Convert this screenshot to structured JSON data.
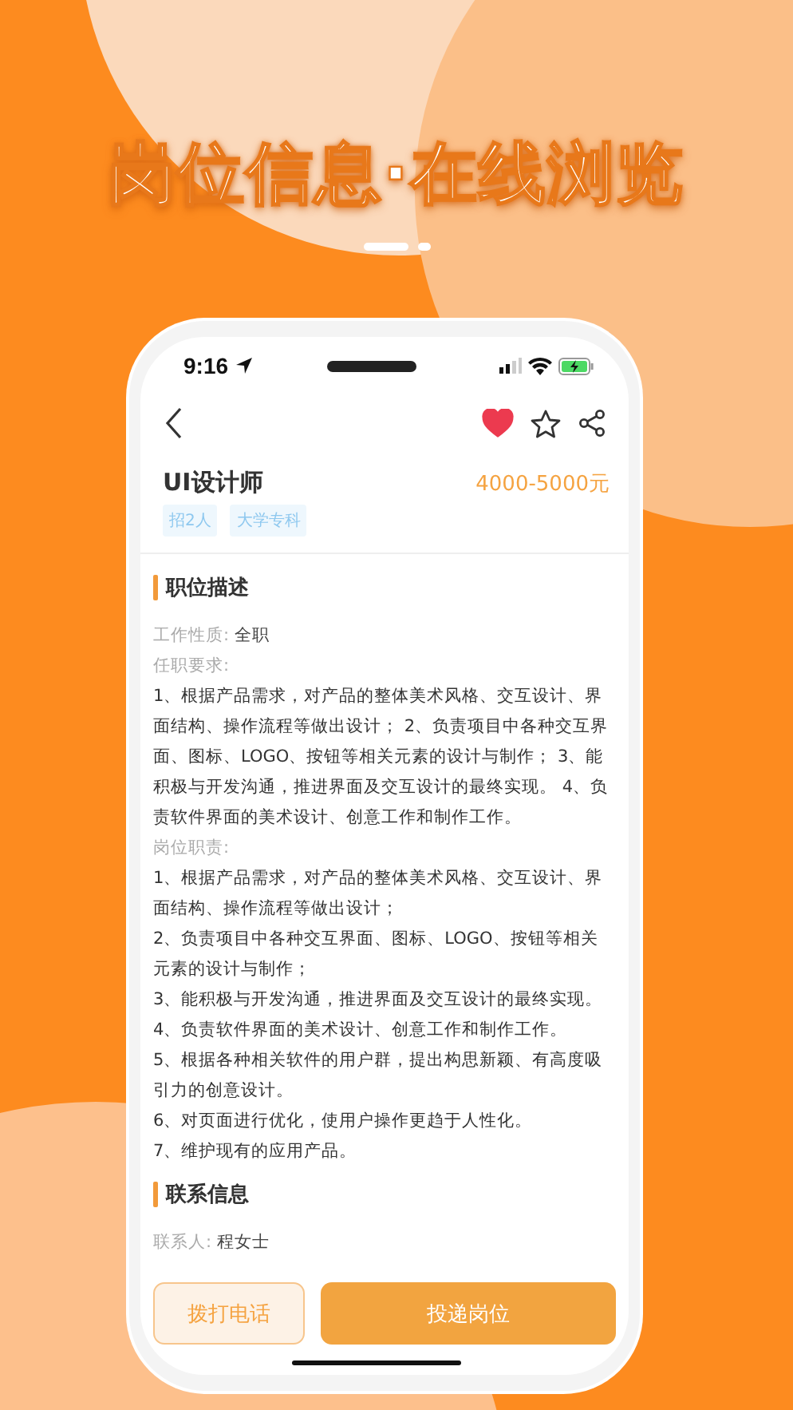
{
  "headline": "岗位信息·在线浏览",
  "status_bar": {
    "time": "9:16"
  },
  "nav": {
    "liked": true,
    "starred": false
  },
  "job": {
    "title": "UI设计师",
    "salary": "4000-5000元",
    "tags": [
      "招2人",
      "大学专科"
    ]
  },
  "sections": [
    {
      "title": "职位描述",
      "blocks": [
        {
          "kind": "field",
          "label": "工作性质:",
          "value": "全职"
        },
        {
          "kind": "label",
          "text": "任职要求:"
        },
        {
          "kind": "text",
          "text": "1、根据产品需求，对产品的整体美术风格、交互设计、界面结构、操作流程等做出设计； 2、负责项目中各种交互界面、图标、LOGO、按钮等相关元素的设计与制作； 3、能积极与开发沟通，推进界面及交互设计的最终实现。 4、负责软件界面的美术设计、创意工作和制作工作。"
        },
        {
          "kind": "label",
          "text": "岗位职责:"
        },
        {
          "kind": "text",
          "text": "1、根据产品需求，对产品的整体美术风格、交互设计、界面结构、操作流程等做出设计；"
        },
        {
          "kind": "text",
          "text": "2、负责项目中各种交互界面、图标、LOGO、按钮等相关元素的设计与制作；"
        },
        {
          "kind": "text",
          "text": "3、能积极与开发沟通，推进界面及交互设计的最终实现。"
        },
        {
          "kind": "text",
          "text": "4、负责软件界面的美术设计、创意工作和制作工作。"
        },
        {
          "kind": "text",
          "text": "5、根据各种相关软件的用户群，提出构思新颖、有高度吸引力的创意设计。"
        },
        {
          "kind": "text",
          "text": "6、对页面进行优化，使用户操作更趋于人性化。"
        },
        {
          "kind": "text",
          "text": "7、维护现有的应用产品。"
        }
      ]
    },
    {
      "title": "联系信息",
      "blocks": [
        {
          "kind": "field",
          "label": "联系人:",
          "value": "程女士"
        }
      ]
    }
  ],
  "actions": {
    "secondary": "拨打电话",
    "primary": "投递岗位"
  }
}
